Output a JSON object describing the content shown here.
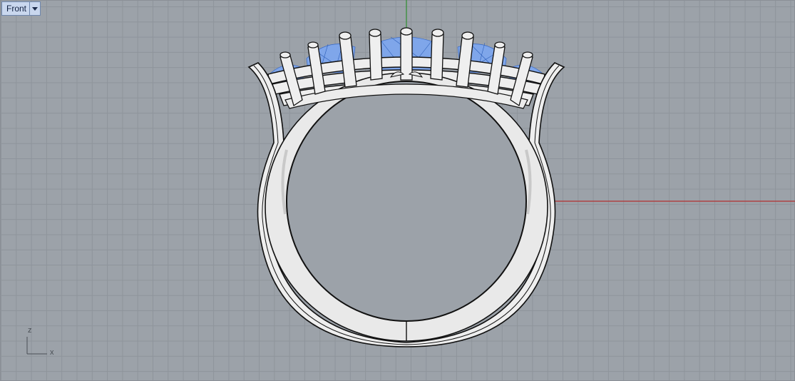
{
  "viewport": {
    "title": "Front",
    "menu_icon": "chevron-down-icon",
    "background_color": "#9ca2a9",
    "grid_color": "#8e949b"
  },
  "axes": {
    "x_color": "#b23030",
    "y_color": "#2f8f2f",
    "gizmo_x_label": "x",
    "gizmo_z_label": "z"
  },
  "model": {
    "metal_color": "#eeeeee",
    "outline_color": "#111111",
    "gem_color": "#7fa6ea"
  }
}
